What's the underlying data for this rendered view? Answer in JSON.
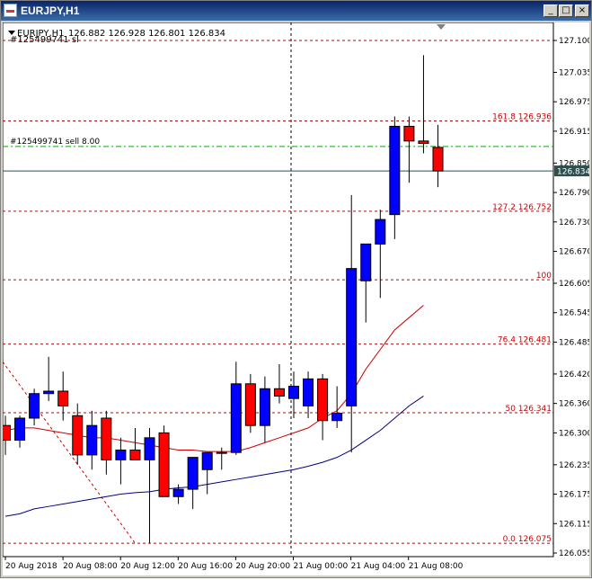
{
  "window": {
    "title": "EURJPY,H1",
    "buttons": {
      "minimize": "_",
      "restore": "□",
      "close": "×"
    }
  },
  "chart_header": {
    "symbol": "EURJPY,H1",
    "ohlc": "126.882 126.928 126.801 126.834",
    "order_ref": "#125499741 sl"
  },
  "chart_data": {
    "type": "candlestick",
    "symbol": "EURJPY",
    "timeframe": "H1",
    "price_axis": {
      "ticks": [
        "127.100",
        "127.035",
        "126.975",
        "126.915",
        "126.850",
        "126.790",
        "126.730",
        "126.670",
        "126.605",
        "126.545",
        "126.485",
        "126.420",
        "126.360",
        "126.300",
        "126.235",
        "126.175",
        "126.115",
        "126.055"
      ],
      "min": 126.055,
      "max": 127.1,
      "current_price": "126.834",
      "current_value": 126.834
    },
    "time_axis": {
      "labels": [
        "20 Aug 2018",
        "20 Aug 08:00",
        "20 Aug 12:00",
        "20 Aug 16:00",
        "20 Aug 20:00",
        "21 Aug 00:00",
        "21 Aug 04:00",
        "21 Aug 08:00"
      ]
    },
    "candles": [
      {
        "o": 126.315,
        "h": 126.335,
        "l": 126.255,
        "c": 126.285
      },
      {
        "o": 126.285,
        "h": 126.335,
        "l": 126.27,
        "c": 126.33
      },
      {
        "o": 126.33,
        "h": 126.39,
        "l": 126.315,
        "c": 126.38
      },
      {
        "o": 126.38,
        "h": 126.455,
        "l": 126.365,
        "c": 126.385
      },
      {
        "o": 126.385,
        "h": 126.425,
        "l": 126.325,
        "c": 126.355
      },
      {
        "o": 126.335,
        "h": 126.36,
        "l": 126.235,
        "c": 126.255
      },
      {
        "o": 126.255,
        "h": 126.345,
        "l": 126.225,
        "c": 126.315
      },
      {
        "o": 126.33,
        "h": 126.345,
        "l": 126.215,
        "c": 126.245
      },
      {
        "o": 126.245,
        "h": 126.29,
        "l": 126.195,
        "c": 126.265
      },
      {
        "o": 126.265,
        "h": 126.31,
        "l": 126.245,
        "c": 126.245
      },
      {
        "o": 126.245,
        "h": 126.31,
        "l": 126.075,
        "c": 126.29
      },
      {
        "o": 126.3,
        "h": 126.315,
        "l": 126.17,
        "c": 126.17
      },
      {
        "o": 126.17,
        "h": 126.195,
        "l": 126.155,
        "c": 126.185
      },
      {
        "o": 126.185,
        "h": 126.235,
        "l": 126.145,
        "c": 126.25
      },
      {
        "o": 126.225,
        "h": 126.255,
        "l": 126.175,
        "c": 126.26
      },
      {
        "o": 126.26,
        "h": 126.27,
        "l": 126.225,
        "c": 126.26
      },
      {
        "o": 126.26,
        "h": 126.445,
        "l": 126.255,
        "c": 126.4
      },
      {
        "o": 126.4,
        "h": 126.42,
        "l": 126.3,
        "c": 126.315
      },
      {
        "o": 126.315,
        "h": 126.415,
        "l": 126.28,
        "c": 126.39
      },
      {
        "o": 126.39,
        "h": 126.44,
        "l": 126.36,
        "c": 126.375
      },
      {
        "o": 126.37,
        "h": 126.425,
        "l": 126.33,
        "c": 126.395
      },
      {
        "o": 126.355,
        "h": 126.425,
        "l": 126.33,
        "c": 126.41
      },
      {
        "o": 126.41,
        "h": 126.42,
        "l": 126.285,
        "c": 126.325
      },
      {
        "o": 126.325,
        "h": 126.395,
        "l": 126.31,
        "c": 126.34
      },
      {
        "o": 126.355,
        "h": 126.785,
        "l": 126.26,
        "c": 126.635
      },
      {
        "o": 126.61,
        "h": 126.685,
        "l": 126.525,
        "c": 126.685
      },
      {
        "o": 126.685,
        "h": 126.755,
        "l": 126.575,
        "c": 126.735
      },
      {
        "o": 126.745,
        "h": 126.945,
        "l": 126.695,
        "c": 126.925
      },
      {
        "o": 126.925,
        "h": 126.945,
        "l": 126.81,
        "c": 126.895
      },
      {
        "o": 126.895,
        "h": 127.07,
        "l": 126.87,
        "c": 126.89
      },
      {
        "o": 126.882,
        "h": 126.928,
        "l": 126.801,
        "c": 126.834
      }
    ],
    "ma_red": [
      126.305,
      126.31,
      126.31,
      126.305,
      126.3,
      126.295,
      126.29,
      126.29,
      126.285,
      126.28,
      126.275,
      126.27,
      126.265,
      126.265,
      126.262,
      126.262,
      126.262,
      126.27,
      126.28,
      126.29,
      126.3,
      126.31,
      126.33,
      126.345,
      126.38,
      126.43,
      126.47,
      126.51,
      126.535,
      126.56
    ],
    "ma_blue": [
      126.13,
      126.135,
      126.145,
      126.15,
      126.155,
      126.16,
      126.165,
      126.17,
      126.175,
      126.178,
      126.18,
      126.185,
      126.188,
      126.19,
      126.195,
      126.2,
      126.205,
      126.21,
      126.215,
      126.22,
      126.225,
      126.232,
      126.24,
      126.25,
      126.265,
      126.285,
      126.305,
      126.33,
      126.355,
      126.375
    ],
    "fibonacci": [
      {
        "label": "161.8 126.936",
        "price": 126.936
      },
      {
        "label": "127.2 126.752",
        "price": 126.752
      },
      {
        "label": "100",
        "price": 126.612
      },
      {
        "label": "76.4 126.481",
        "price": 126.481
      },
      {
        "label": "50 126.341",
        "price": 126.341
      },
      {
        "label": "0.0 126.075",
        "price": 126.075
      }
    ],
    "top_level_line": 127.1,
    "order": {
      "label": "#125499741 sell 8.00",
      "price": 126.884
    },
    "colors": {
      "bull": "#0000ff",
      "bear": "#ff0000",
      "fib": "#cc0000",
      "order": "#00aa00",
      "bid_line": "#2f4f4f",
      "ma_red": "#cc0000",
      "ma_blue": "#000080"
    }
  }
}
